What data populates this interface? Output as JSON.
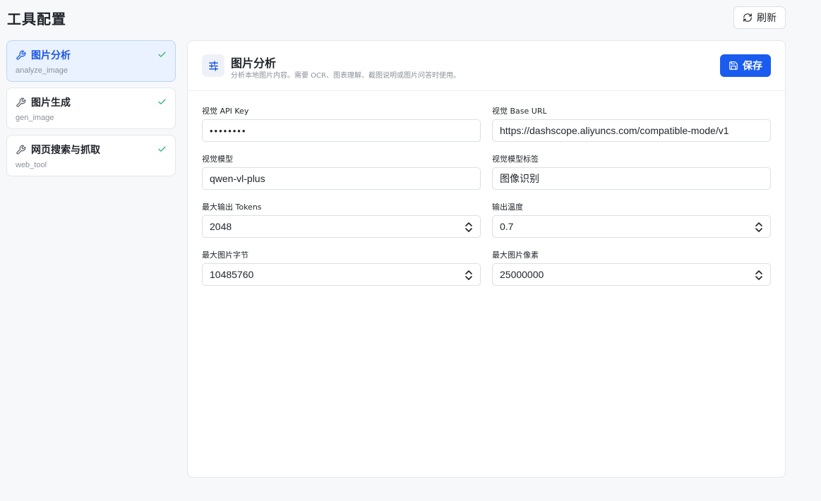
{
  "header": {
    "title": "工具配置",
    "refresh_label": "刷新"
  },
  "tools": [
    {
      "name": "图片分析",
      "id": "analyze_image",
      "active": true
    },
    {
      "name": "图片生成",
      "id": "gen_image",
      "active": false
    },
    {
      "name": "网页搜索与抓取",
      "id": "web_tool",
      "active": false
    }
  ],
  "panel": {
    "title": "图片分析",
    "description": "分析本地图片内容。需要 OCR、图表理解、截图说明或图片问答时使用。",
    "save_label": "保存"
  },
  "fields": {
    "api_key": {
      "label": "视觉 API Key",
      "value": "••••••••"
    },
    "base_url": {
      "label": "视觉 Base URL",
      "value": "https://dashscope.aliyuncs.com/compatible-mode/v1"
    },
    "model": {
      "label": "视觉模型",
      "value": "qwen-vl-plus"
    },
    "model_tag": {
      "label": "视觉模型标签",
      "value": "图像识别"
    },
    "max_tokens": {
      "label": "最大输出 Tokens",
      "value": "2048"
    },
    "temperature": {
      "label": "输出温度",
      "value": "0.7"
    },
    "max_bytes": {
      "label": "最大图片字节",
      "value": "10485760"
    },
    "max_pixels": {
      "label": "最大图片像素",
      "value": "25000000"
    }
  },
  "icons": {
    "refresh": "refresh-icon",
    "wrench": "wrench-icon",
    "check": "check-icon",
    "sliders": "sliders-icon",
    "save": "save-icon",
    "stepper": "chevron-up-down-icon"
  },
  "colors": {
    "accent": "#1a5cf0",
    "active_bg": "#eaf2ff",
    "check": "#2bb673"
  }
}
